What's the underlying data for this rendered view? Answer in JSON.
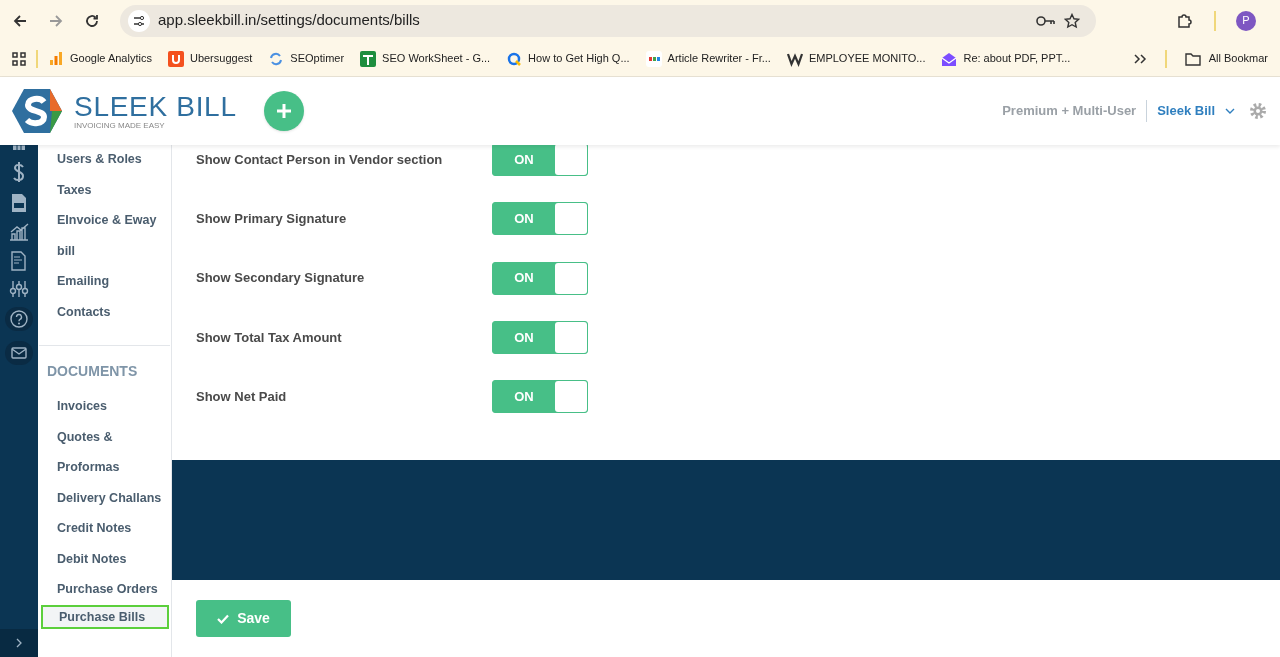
{
  "browser": {
    "url": "app.sleekbill.in/settings/documents/bills",
    "avatar": "P",
    "bookmarks": [
      {
        "label": "Google Analytics"
      },
      {
        "label": "Ubersuggest"
      },
      {
        "label": "SEOptimer"
      },
      {
        "label": "SEO WorkSheet - G..."
      },
      {
        "label": "How to Get High Q..."
      },
      {
        "label": "Article Rewriter - Fr..."
      },
      {
        "label": "EMPLOYEE MONITO..."
      },
      {
        "label": "Re: about PDF, PPT..."
      }
    ],
    "all_bookmarks": "All Bookmar"
  },
  "header": {
    "logo_name": "SLEEK BILL",
    "logo_tagline": "INVOICING MADE EASY",
    "plan": "Premium + Multi-User",
    "company": "Sleek Bill"
  },
  "sidebar": {
    "top_items": [
      {
        "label": "Users & Roles",
        "selected": false
      },
      {
        "label": "Taxes",
        "selected": false
      },
      {
        "label": "EInvoice & Eway bill",
        "selected": false
      },
      {
        "label": "Emailing",
        "selected": false
      },
      {
        "label": "Contacts",
        "selected": false
      }
    ],
    "section": "DOCUMENTS",
    "document_items": [
      {
        "label": "Invoices",
        "selected": false
      },
      {
        "label": "Quotes & Proformas",
        "selected": false
      },
      {
        "label": "Delivery Challans",
        "selected": false
      },
      {
        "label": "Credit Notes",
        "selected": false
      },
      {
        "label": "Debit Notes",
        "selected": false
      },
      {
        "label": "Purchase Orders",
        "selected": false
      },
      {
        "label": "Purchase Bills",
        "selected": true
      }
    ]
  },
  "settings": [
    {
      "label": "Show Contact Person in Vendor section",
      "on": true,
      "state_label": "ON"
    },
    {
      "label": "Show Primary Signature",
      "on": true,
      "state_label": "ON"
    },
    {
      "label": "Show Secondary Signature",
      "on": true,
      "state_label": "ON"
    },
    {
      "label": "Show Total Tax Amount",
      "on": true,
      "state_label": "ON"
    },
    {
      "label": "Show Net Paid",
      "on": true,
      "state_label": "ON"
    }
  ],
  "save_button": "Save"
}
